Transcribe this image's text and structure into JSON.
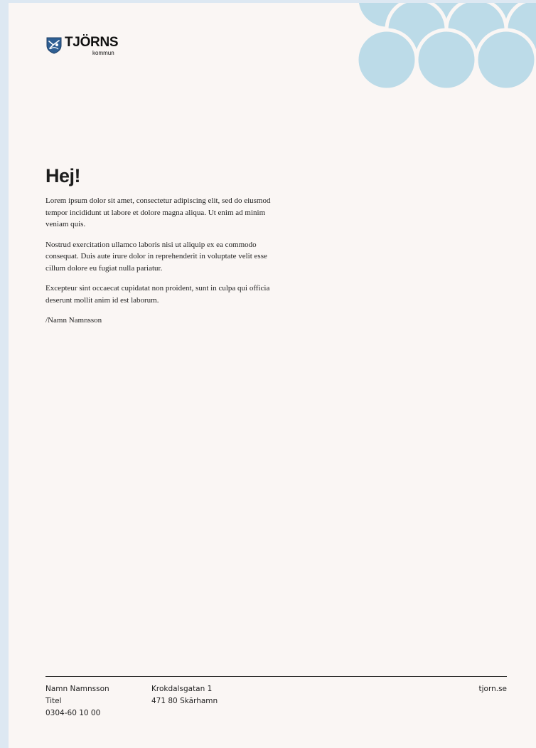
{
  "logo": {
    "name": "TJÖRNS",
    "subtitle": "kommun",
    "icon": "coat-of-arms-icon"
  },
  "colors": {
    "page_background": "#faf6f4",
    "outer_background": "#dde8f2",
    "scale_pattern": "#bcdbe8",
    "text": "#222222"
  },
  "letter": {
    "greeting": "Hej!",
    "paragraphs": [
      "Lorem ipsum dolor sit amet, consectetur adipiscing elit, sed do eiusmod tempor incididunt ut labore et dolore magna aliqua. Ut enim ad minim veniam quis.",
      "Nostrud exercitation ullamco laboris nisi ut aliquip ex ea commodo consequat. Duis aute irure dolor in reprehenderit in voluptate velit esse cillum dolore eu fugiat nulla pariatur.",
      "Excepteur sint occaecat cupidatat non proident, sunt in culpa qui officia deserunt mollit anim id est laborum."
    ],
    "signature": "/Namn Namnsson"
  },
  "footer": {
    "contact": {
      "name": "Namn Namnsson",
      "title": "Titel",
      "phone": "0304-60 10 00"
    },
    "address": {
      "street": "Krokdalsgatan 1",
      "postal": "471 80 Skärhamn"
    },
    "website": "tjorn.se"
  }
}
